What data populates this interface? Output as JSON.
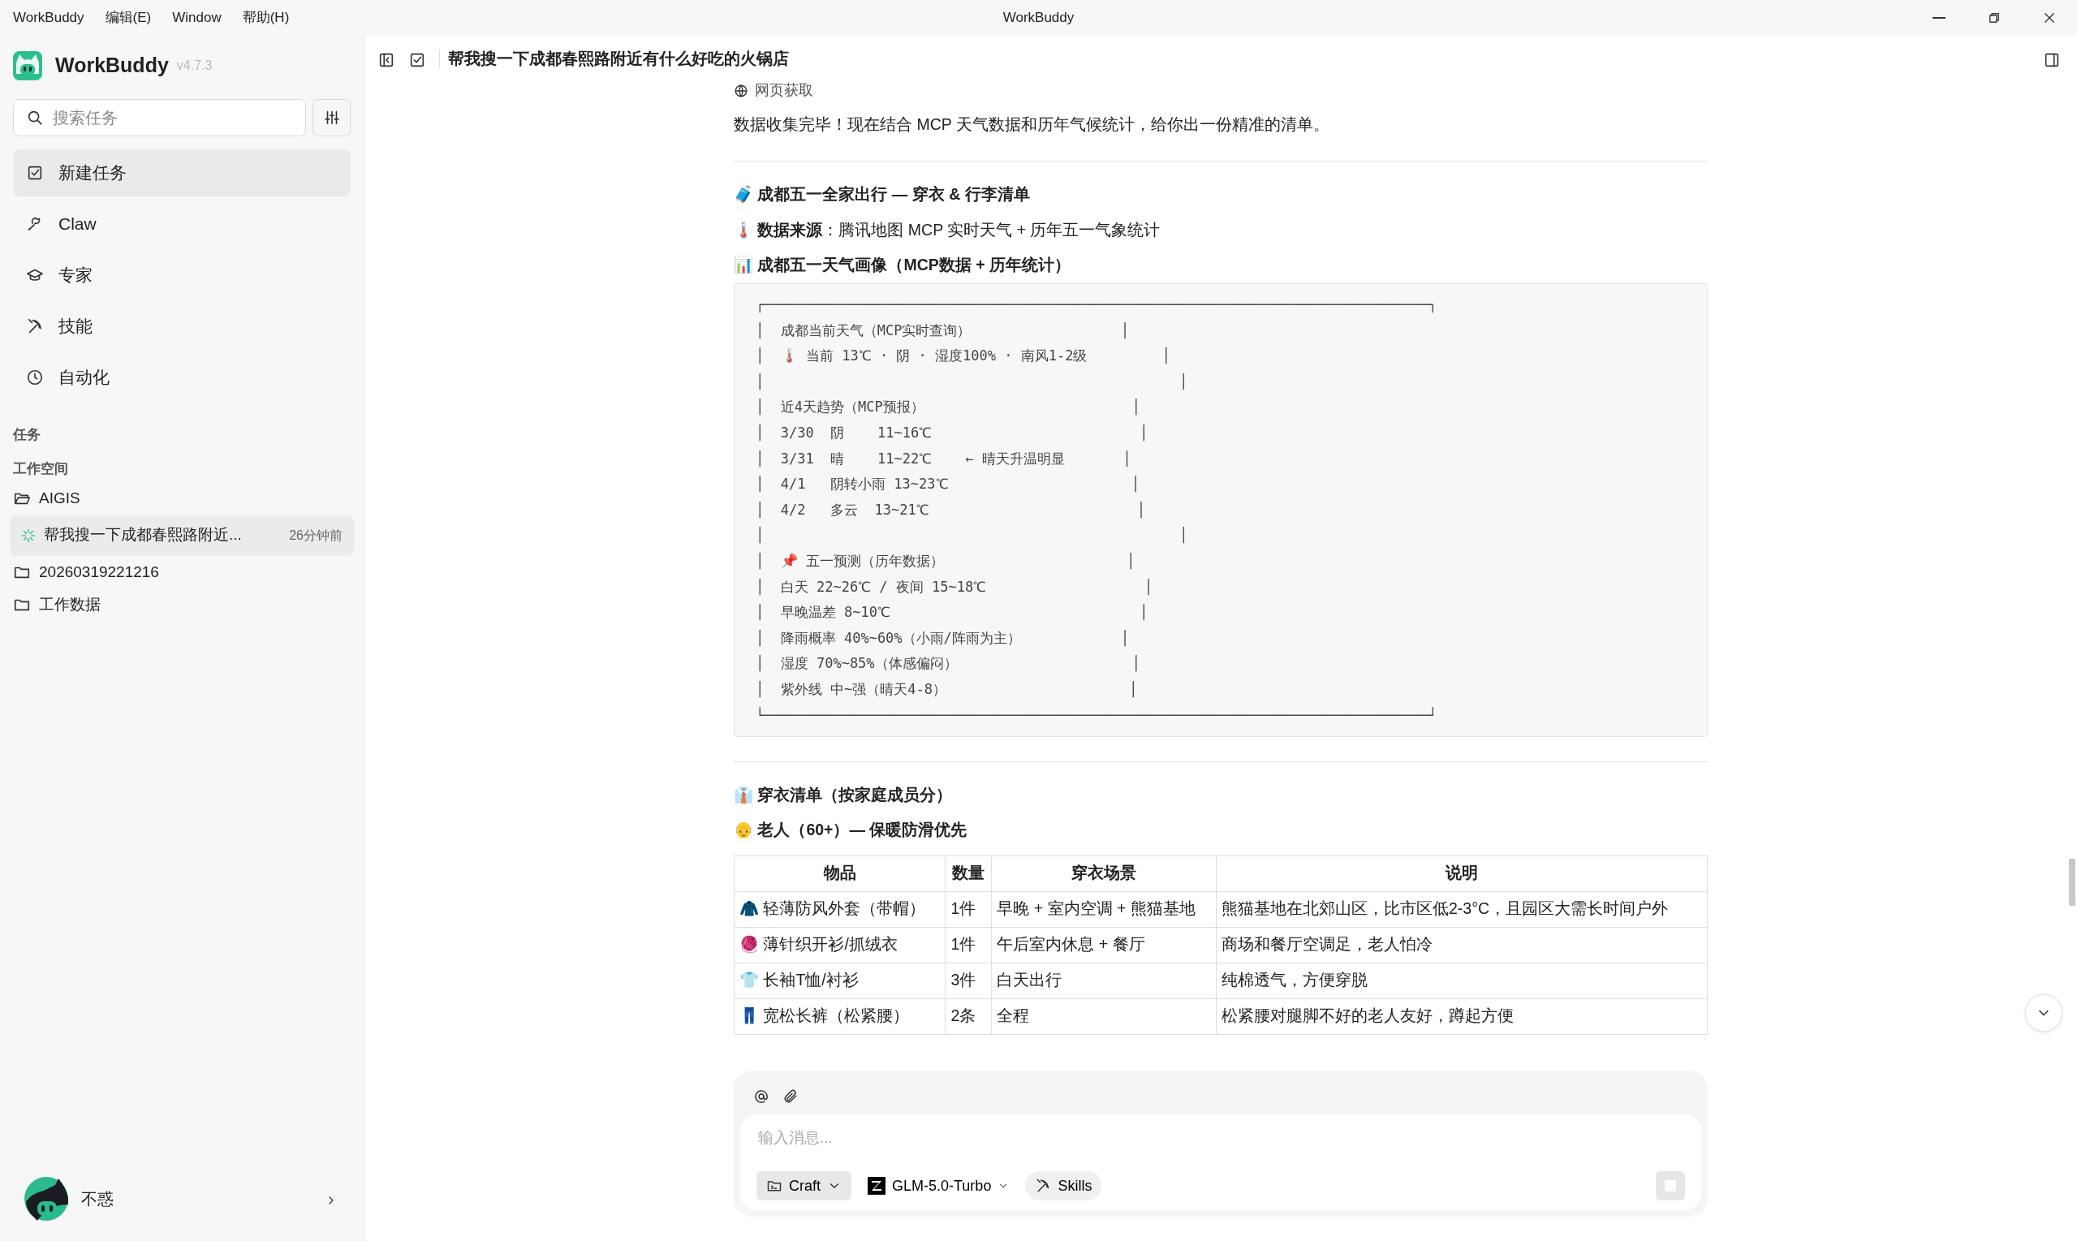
{
  "window": {
    "title": "WorkBuddy",
    "menu": [
      "WorkBuddy",
      "编辑(E)",
      "Window",
      "帮助(H)"
    ]
  },
  "sidebar": {
    "app_name": "WorkBuddy",
    "version": "v4.7.3",
    "search": {
      "placeholder": "搜索任务"
    },
    "nav": [
      {
        "label": "新建任务",
        "selected": true
      },
      {
        "label": "Claw",
        "selected": false
      },
      {
        "label": "专家",
        "selected": false
      },
      {
        "label": "技能",
        "selected": false
      },
      {
        "label": "自动化",
        "selected": false
      }
    ],
    "tasks_heading": "任务",
    "workspace_heading": "工作空间",
    "workspaces": [
      {
        "name": "AIGIS",
        "expanded": true,
        "tasks": [
          {
            "title": "帮我搜一下成都春熙路附近...",
            "time": "26分钟前",
            "selected": true
          }
        ]
      },
      {
        "name": "20260319221216",
        "expanded": false
      },
      {
        "name": "工作数据",
        "expanded": false
      }
    ],
    "user": {
      "name": "不惑"
    }
  },
  "chat": {
    "title": "帮我搜一下成都春熙路附近有什么好吃的火锅店",
    "tool_step": "网页获取",
    "blocks": [
      {
        "kind": "paragraph",
        "text": "数据收集完毕！现在结合 MCP 天气数据和历年气候统计，给你出一份精准的清单。"
      },
      {
        "kind": "divider"
      },
      {
        "kind": "heading",
        "text": "🧳 成都五一全家出行 — 穿衣 & 行李清单"
      },
      {
        "kind": "paragraph",
        "text": "🌡️ **数据来源**：腾讯地图 MCP 实时天气 + 历年五一气象统计"
      },
      {
        "kind": "heading",
        "text": "📊 成都五一天气画像（MCP数据 + 历年统计）"
      },
      {
        "kind": "code",
        "lines": [
          "┌────────────────────────────────────────────────────────────────────────────────┐",
          "│  成都当前天气（MCP实时查询）                  │",
          "│  🌡️ 当前 13℃ · 阴 · 湿度100% · 南风1-2级         │",
          "│                                                  │",
          "│  近4天趋势（MCP预报）                         │",
          "│  3/30  阴    11~16℃                         │",
          "│  3/31  晴    11~22℃    ← 晴天升温明显       │",
          "│  4/1   阴转小雨 13~23℃                      │",
          "│  4/2   多云  13~21℃                         │",
          "│                                                  │",
          "│  📌 五一预测（历年数据）                      │",
          "│  白天 22~26℃ / 夜间 15~18℃                   │",
          "│  早晚温差 8~10℃                              │",
          "│  降雨概率 40%~60%（小雨/阵雨为主）            │",
          "│  湿度 70%~85%（体感偏闷）                     │",
          "│  紫外线 中~强（晴天4-8）                      │",
          "└────────────────────────────────────────────────────────────────────────────────┘"
        ]
      },
      {
        "kind": "divider"
      },
      {
        "kind": "heading",
        "text": "👔 穿衣清单（按家庭成员分）"
      },
      {
        "kind": "heading",
        "text": "👴 老人（60+）— 保暖防滑优先"
      },
      {
        "kind": "table",
        "columns": [
          "物品",
          "数量",
          "穿衣场景",
          "说明"
        ],
        "rows": [
          [
            "🧥 轻薄防风外套（带帽）",
            "1件",
            "早晚 + 室内空调 + 熊猫基地",
            "熊猫基地在北郊山区，比市区低2-3°C，且园区大需长时间户外"
          ],
          [
            "🧶 薄针织开衫/抓绒衣",
            "1件",
            "午后室内休息 + 餐厅",
            "商场和餐厅空调足，老人怕冷"
          ],
          [
            "👕 长袖T恤/衬衫",
            "3件",
            "白天出行",
            "纯棉透气，方便穿脱"
          ],
          [
            "👖 宽松长裤（松紧腰）",
            "2条",
            "全程",
            "松紧腰对腿脚不好的老人友好，蹲起方便"
          ]
        ]
      }
    ],
    "composer": {
      "placeholder": "输入消息...",
      "mode": "Craft",
      "model": "GLM-5.0-Turbo",
      "skills": "Skills"
    }
  }
}
